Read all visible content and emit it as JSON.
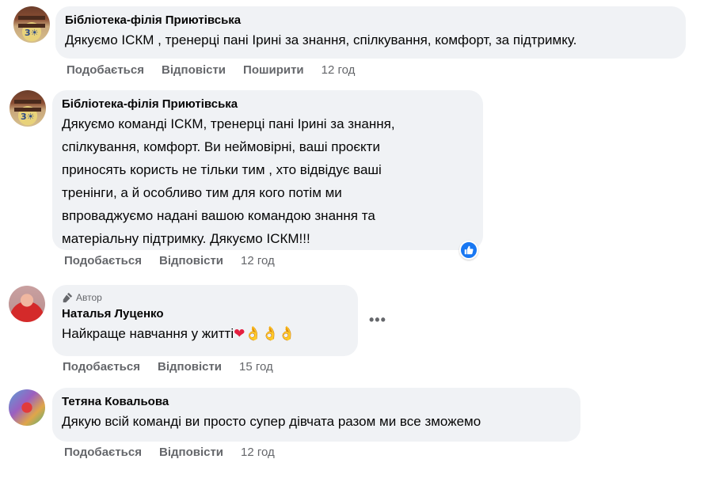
{
  "actions": {
    "like": "Подобається",
    "reply": "Відповісти",
    "share": "Поширити"
  },
  "comments": [
    {
      "author": "Бібліотека-філія Приютівська",
      "text": "Дякуємо ІСКМ , тренерці пані Ірині за знання, спілкування, комфорт, за підтримку.",
      "time": "12 год",
      "avatar_icon": "library-avatar"
    },
    {
      "author": "Бібліотека-філія Приютівська",
      "text_lines": [
        "Дякуємо команді ІСКМ, тренерці пані Ірині за знання,",
        "спілкування, комфорт. Ви неймовірні, ваші проєкти",
        "приносять користь не тільки тим , хто відвідує ваші",
        "тренінги, а й особливо тим для кого потім ми",
        "впроваджуємо надані вашою командою знання та",
        "матеріальну підтримку. Дякуємо ІСКМ!!!"
      ],
      "time": "12 год",
      "reaction_icon": "like-reaction-icon"
    },
    {
      "badge": "Автор",
      "author": "Наталья Луценко",
      "text": "Найкраще навчання у житті",
      "emojis": "❤👌👌👌",
      "time": "15 год"
    },
    {
      "author": "Тетяна Ковальова",
      "text": "Дякую всій команді ви просто супер дівчата разом ми все зможемо",
      "time": "12 год"
    }
  ],
  "colors": {
    "bubble": "#f0f2f5",
    "secondary_text": "#65676b",
    "like_blue": "#1877f2"
  }
}
